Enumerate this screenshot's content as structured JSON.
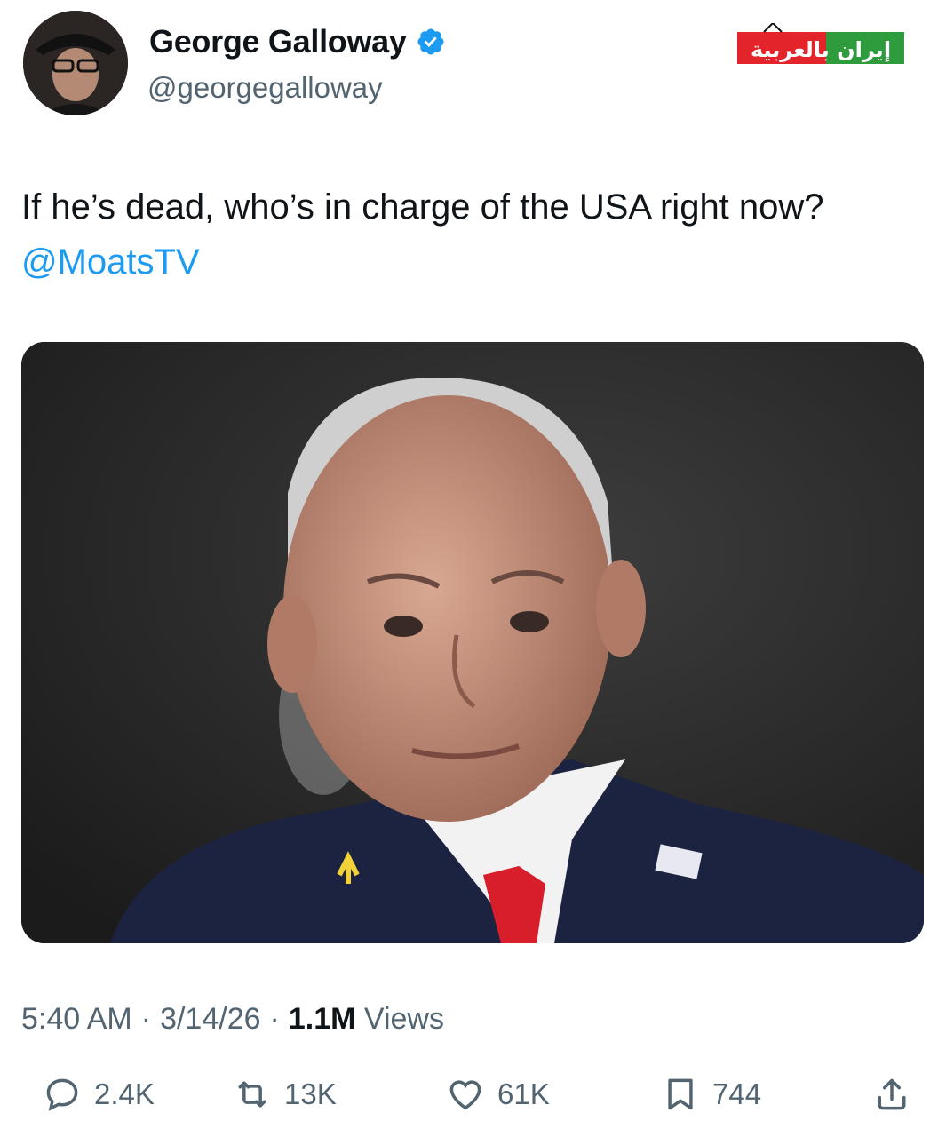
{
  "author": {
    "name": "George Galloway",
    "handle": "@georgegalloway",
    "verified": true
  },
  "watermark": {
    "logo_text": "إيران بالعربية",
    "colors": {
      "green": "#2e9b3c",
      "red": "#e3242b",
      "white": "#ffffff"
    }
  },
  "tweet": {
    "text": "If he’s dead, who’s in charge of the USA right now?",
    "mention": "@MoatsTV"
  },
  "media": {
    "description_icon": "portrait-photo-icon"
  },
  "meta": {
    "time": "5:40 AM",
    "sep1": "·",
    "date": "3/14/26",
    "sep2": "·",
    "views_count": "1.1M",
    "views_label": "Views"
  },
  "actions": {
    "replies": "2.4K",
    "reposts": "13K",
    "likes": "61K",
    "bookmarks": "744"
  },
  "colors": {
    "accent": "#1d9bf0",
    "text": "#0f1419",
    "muted": "#536471"
  }
}
